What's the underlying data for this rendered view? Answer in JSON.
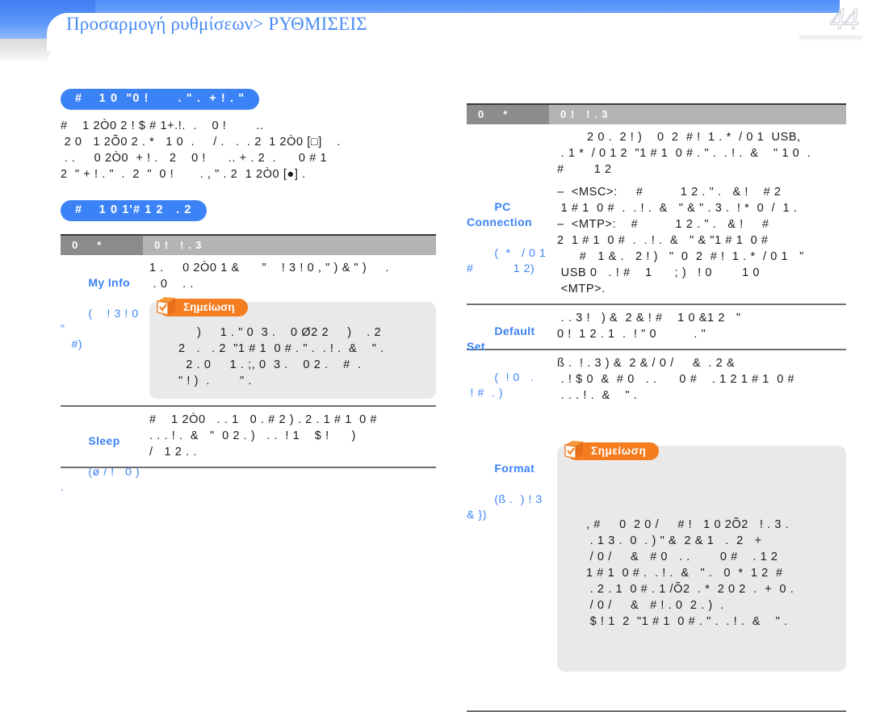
{
  "header": {
    "breadcrumb_first": "Προσαρμογή ρυθμίσεων",
    "breadcrumb_separator": ">",
    "breadcrumb_last": "ΡΥΘΜΙΣΕΙΣ",
    "page_number": "44",
    "accent_blue": "#4a8cf7"
  },
  "left_column": {
    "heading1": "#    1 0  \"0 !       . \" .  + ! . \"",
    "paragraph1": "#    1 2Ò0 2 ! $ # 1+.!.  .    0 !        ..\n 2 0   1 2Õ0 2 . *   1 0  .     / .   .  . 2  1 2Ò0 [□]    .\n . .     0 2Ò0  + ! .   2    0 !      .. + . 2  .      0 # 1\n2  \" + ! . \"  .  2  \"  0 !       . , \" . 2  1 2Ò0 [●] .",
    "heading2": "#    1 0 1'# 1 2   . 2",
    "table": {
      "header": {
        "col1": "0     *",
        "col2": "0 !   ! . 3"
      },
      "rows": [
        {
          "label": "My Info",
          "label_sub": "(    ! 3 ! 0 \"\n   #)",
          "body": "1 .     0 2Ò0 1 &      \"    ! 3 ! 0 , \" ) & \" )     .\n . 0    . .",
          "note": {
            "tag": "Σημείωση",
            "text": "     )     1 . \" 0  3 .    0 Ø2 2     )    . 2\n2   .   . 2  \"1 # 1  0 # . \" .  . ! .  &    \" .\n  2 . 0     1 . ;, 0  3 .    0 2 .    #  .\n\" ! )  .        \" ."
          }
        },
        {
          "label": "Sleep",
          "label_sub": "(ø / !   0 ) .",
          "body": "#    1 2Ò0   . . 1   0 . # 2 ) . 2 . 1 # 1  0 #\n. . . ! .  &   \"  0 2 . )   . .  ! 1    $ !      )\n/   1 2 . ."
        }
      ]
    }
  },
  "right_column": {
    "table": {
      "header": {
        "col1": "0     *",
        "col2": "0 !   ! . 3"
      },
      "rows": [
        {
          "label": "",
          "label_sub": "",
          "body": "        2 0 .  2 ! )    0  2  # !  1 . *  / 0 1  USB,\n . 1 *  / 0 1 2  \"1 # 1  0 # . \" .  . ! .  &    \" 1 0  .\n#        1 2"
        },
        {
          "label": "PC\nConnection",
          "label_sub": "(  *   / 0 1\n#           1 2)",
          "body": "–  <MSC>:     #          1 2 . \" .   & !    # 2\n 1 # 1  0 #  .  . ! .  &   \" & \" . 3 .  ! *  0  /  1 .\n–  <MTP>:    #          1 2 . \" .   & !     #\n2  1 # 1  0 #  .  . ! .  &   \" & \"1 # 1  0 #\n      #   1 & .   2 ! )   \"  0  2  # !  1 . *  / 0 1   \"\n USB 0   . ! #    1      ; )   ! 0        1 0\n <MTP>."
        },
        {
          "label": "Default Set",
          "label_sub": "(  ! 0   .\n ! #  . )",
          "body": " . . 3 !   ) &  2 & ! #    1 0 &1 2   \"\n0 !  1 2 . 1  .  ! \" 0          . \""
        },
        {
          "label": "",
          "label_sub": "",
          "body": "ß .  ! . 3 ) &  2 & / 0 /     &  . 2 &\n . ! $ 0  &  # 0   . .      0 #    . 1 2 1 # 1  0 #\n . . . ! .  &    \" ."
        },
        {
          "label": "Format",
          "label_sub": "(ß .  ) ! 3 & })",
          "note": {
            "tag": "Σημείωση",
            "text": ", #     0  2 0 /     # !   1 0 2Õ2   ! . 3 .\n . 1 3 .  0  . ) \" &  2 & 1   .  2   +\n / 0 /     &   # 0   . .        0 #    . 1 2\n1 # 1  0 # .  . ! .  &   \" .   0  *  1 2  #\n . 2 . 1  0 # . 1 /Õ2  . *  2 0 2  .  +  0 .\n / 0 /     &   # ! . 0  2 . )  .\n $ ! 1  2  \"1 # 1  0 # . \" .  . ! .  &    \" ."
          }
        }
      ]
    }
  },
  "icons": {
    "note_box_icon": "note-cube-icon"
  }
}
